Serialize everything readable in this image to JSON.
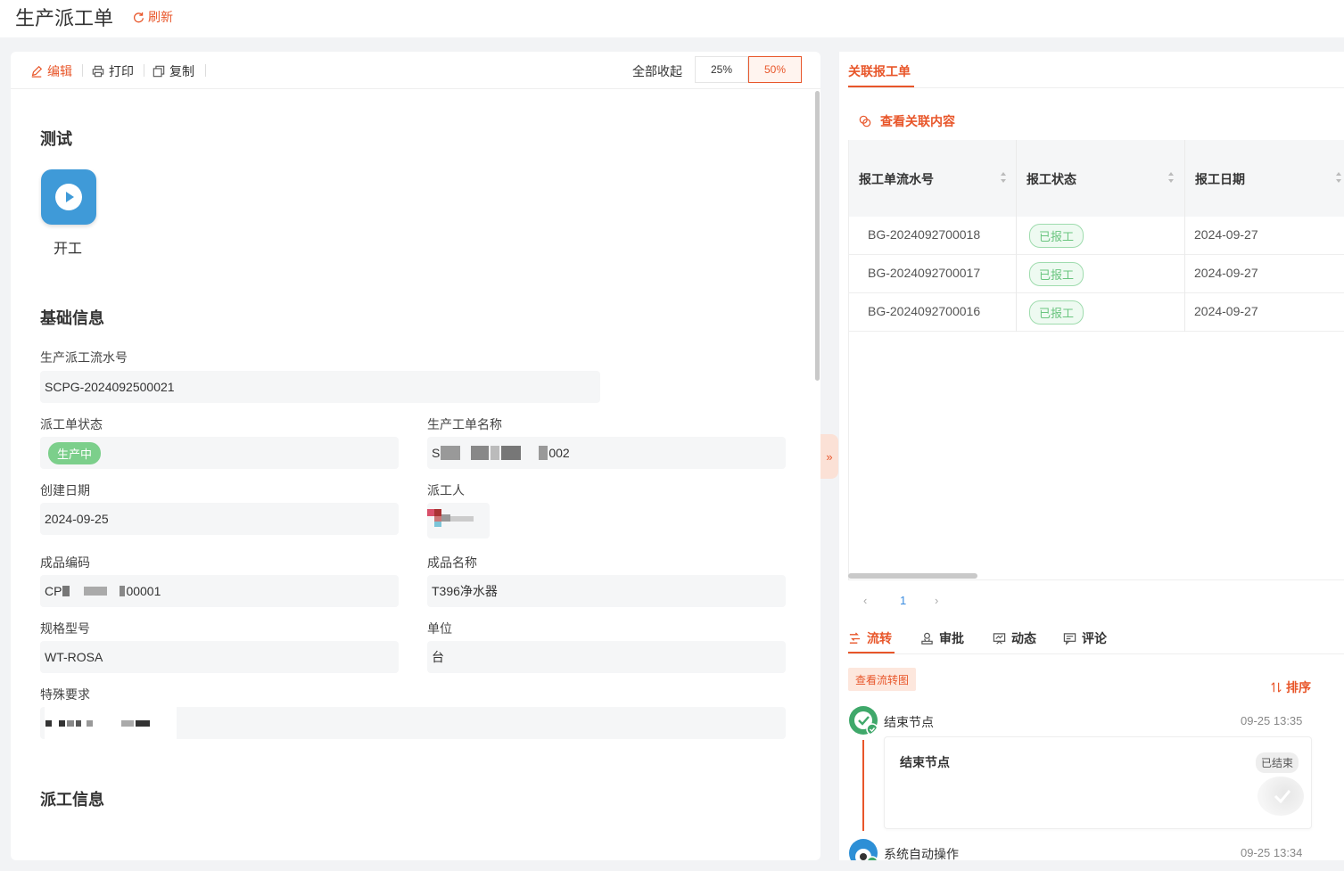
{
  "header": {
    "title": "生产派工单",
    "refresh_label": "刷新"
  },
  "toolbar": {
    "edit_label": "编辑",
    "print_label": "打印",
    "copy_label": "复制",
    "collapse_all_label": "全部收起",
    "zoom_options": [
      "25%",
      "50%"
    ],
    "zoom_selected": "50%"
  },
  "sections": {
    "test": {
      "title": "测试",
      "start_label": "开工"
    },
    "basic": {
      "title": "基础信息"
    },
    "dispatch": {
      "title": "派工信息"
    }
  },
  "fields": {
    "serial_no": {
      "label": "生产派工流水号",
      "value": "SCPG-2024092500021"
    },
    "status": {
      "label": "派工单状态",
      "value": "生产中"
    },
    "work_order_name": {
      "label": "生产工单名称",
      "value_prefix": "S",
      "value_suffix": "002"
    },
    "created_date": {
      "label": "创建日期",
      "value": "2024-09-25"
    },
    "dispatcher": {
      "label": "派工人"
    },
    "product_code": {
      "label": "成品编码",
      "value_prefix": "CP",
      "value_suffix": "00001"
    },
    "product_name": {
      "label": "成品名称",
      "value": "T396净水器"
    },
    "spec_model": {
      "label": "规格型号",
      "value": "WT-ROSA"
    },
    "unit": {
      "label": "单位",
      "value": "台"
    },
    "special_req": {
      "label": "特殊要求"
    }
  },
  "right_panel": {
    "tab_label": "关联报工单",
    "view_related_label": "查看关联内容",
    "table": {
      "columns": [
        "报工单流水号",
        "报工状态",
        "报工日期"
      ],
      "rows": [
        {
          "serial": "BG-2024092700018",
          "status": "已报工",
          "date": "2024-09-27"
        },
        {
          "serial": "BG-2024092700017",
          "status": "已报工",
          "date": "2024-09-27"
        },
        {
          "serial": "BG-2024092700016",
          "status": "已报工",
          "date": "2024-09-27"
        }
      ]
    },
    "pagination": {
      "current": "1",
      "prev": "‹",
      "next": "›"
    },
    "bottom_tabs": [
      "流转",
      "审批",
      "动态",
      "评论"
    ],
    "flow_chart_button": "查看流转图",
    "sort_label": "排序",
    "timeline": [
      {
        "title": "结束节点",
        "time": "09-25 13:35",
        "card_title": "结束节点",
        "card_badge": "已结束"
      },
      {
        "title": "系统自动操作",
        "time": "09-25 13:34"
      }
    ]
  },
  "colors": {
    "accent": "#e8562a",
    "success": "#7ccf8b",
    "start_tile": "#3f9ad8"
  }
}
